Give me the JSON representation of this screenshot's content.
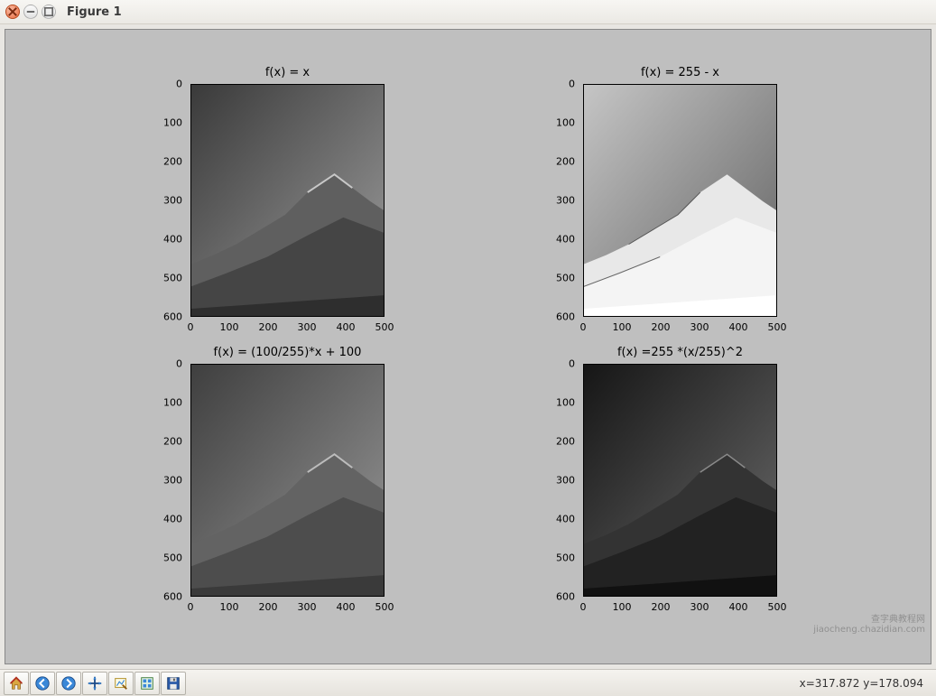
{
  "window": {
    "title": "Figure 1"
  },
  "toolbar": {
    "home": "home-icon",
    "back": "back-icon",
    "forward": "forward-icon",
    "pan": "pan-icon",
    "zoom": "zoom-icon",
    "configure": "configure-icon",
    "save": "save-icon",
    "coord": "x=317.872  y=178.094"
  },
  "chart_data": [
    {
      "type": "image",
      "title": "f(x) = x",
      "description": "Grayscale mountain image, identity transform",
      "xlim": [
        0,
        500
      ],
      "ylim": [
        600,
        0
      ],
      "xticks": [
        0,
        100,
        200,
        300,
        400,
        500
      ],
      "yticks": [
        0,
        100,
        200,
        300,
        400,
        500,
        600
      ],
      "image_brightness": "normal"
    },
    {
      "type": "image",
      "title": "f(x) = 255 - x",
      "description": "Inverted grayscale mountain image",
      "xlim": [
        0,
        500
      ],
      "ylim": [
        600,
        0
      ],
      "xticks": [
        0,
        100,
        200,
        300,
        400,
        500
      ],
      "yticks": [
        0,
        100,
        200,
        300,
        400,
        500,
        600
      ],
      "image_brightness": "inverted"
    },
    {
      "type": "image",
      "title": "f(x) = (100/255)*x + 100",
      "description": "Reduced-contrast grayscale mountain image",
      "xlim": [
        0,
        500
      ],
      "ylim": [
        600,
        0
      ],
      "xticks": [
        0,
        100,
        200,
        300,
        400,
        500
      ],
      "yticks": [
        0,
        100,
        200,
        300,
        400,
        500,
        600
      ],
      "image_brightness": "low-contrast"
    },
    {
      "type": "image",
      "title": "f(x) =255 *(x/255)^2",
      "description": "Darkened (squared) grayscale mountain image",
      "xlim": [
        0,
        500
      ],
      "ylim": [
        600,
        0
      ],
      "xticks": [
        0,
        100,
        200,
        300,
        400,
        500
      ],
      "yticks": [
        0,
        100,
        200,
        300,
        400,
        500,
        600
      ],
      "image_brightness": "dark"
    }
  ],
  "watermark": {
    "line1": "查字典教程网",
    "line2": "jiaocheng.chazidian.com"
  }
}
